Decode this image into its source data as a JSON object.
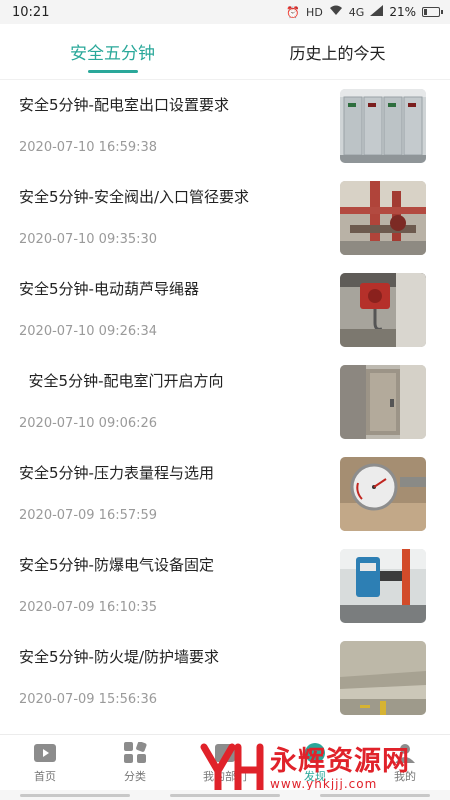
{
  "status_bar": {
    "time": "10:21",
    "network": "HD",
    "signal_label": "4G",
    "battery": "21%",
    "battery_level": 0.21
  },
  "tabs": [
    {
      "label": "安全五分钟",
      "active": true
    },
    {
      "label": "历史上的今天",
      "active": false
    }
  ],
  "articles": [
    {
      "title": "安全5分钟-配电室出口设置要求",
      "date": "2020-07-10 16:59:38",
      "thumb": "switchgear-room-photo"
    },
    {
      "title": "安全5分钟-安全阀出/入口管径要求",
      "date": "2020-07-10 09:35:30",
      "thumb": "valve-pipes-photo"
    },
    {
      "title": "安全5分钟-电动葫芦导绳器",
      "date": "2020-07-10 09:26:34",
      "thumb": "electric-hoist-photo"
    },
    {
      "title": "  安全5分钟-配电室门开启方向",
      "date": "2020-07-10 09:06:26",
      "thumb": "distribution-room-door-photo"
    },
    {
      "title": "安全5分钟-压力表量程与选用",
      "date": "2020-07-09 16:57:59",
      "thumb": "pressure-gauge-photo"
    },
    {
      "title": "安全5分钟-防爆电气设备固定",
      "date": "2020-07-09 16:10:35",
      "thumb": "explosion-proof-motor-photo"
    },
    {
      "title": "安全5分钟-防火堤/防护墙要求",
      "date": "2020-07-09 15:56:36",
      "thumb": "fire-dike-photo"
    }
  ],
  "bottom_nav": [
    {
      "label": "首页",
      "icon": "home-icon"
    },
    {
      "label": "分类",
      "icon": "category-icon"
    },
    {
      "label": "我的部门",
      "icon": "department-icon"
    },
    {
      "label": "发现",
      "icon": "discover-icon"
    },
    {
      "label": "我的",
      "icon": "profile-icon"
    }
  ],
  "watermark": {
    "brand": "永辉资源网",
    "url": "www.yhkjjj.com"
  },
  "colors": {
    "accent": "#2aa89a",
    "watermark": "#e0222a"
  }
}
